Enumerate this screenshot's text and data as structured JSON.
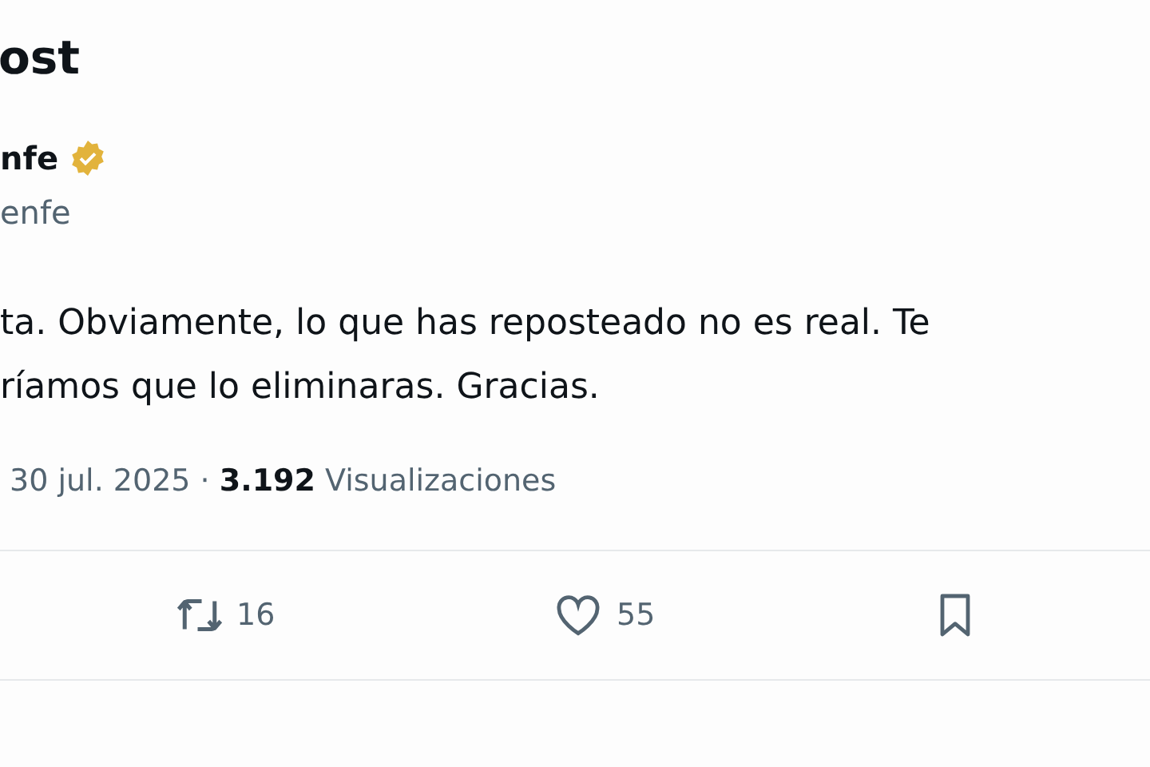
{
  "header": {
    "title": "ost"
  },
  "author": {
    "name": "nfe",
    "verified": true,
    "handle": "enfe"
  },
  "post": {
    "lines": [
      "ta. Obviamente, lo que has reposteado no es real. Te",
      "ríamos que lo eliminaras. Gracias."
    ],
    "meta": "30 jul. 2025 · **3.192** Visualizaciones"
  },
  "actions": [
    {
      "kind": "repost",
      "count": "16"
    },
    {
      "kind": "like",
      "count": "55"
    },
    {
      "kind": "bookmark"
    }
  ]
}
